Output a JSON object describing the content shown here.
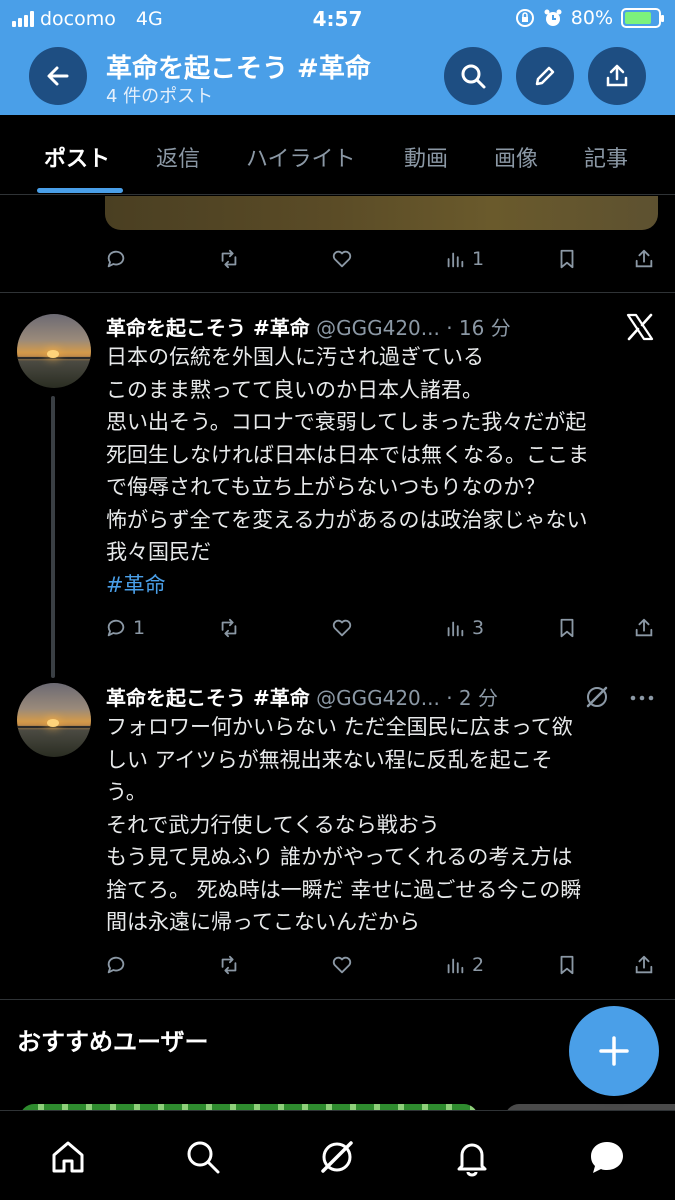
{
  "status_bar": {
    "carrier": "docomo",
    "network": "4G",
    "time": "4:57",
    "battery": "80%"
  },
  "header": {
    "title": "革命を起こそう #革命",
    "subtitle": "4 件のポスト"
  },
  "tabs": [
    {
      "label": "ポスト"
    },
    {
      "label": "返信"
    },
    {
      "label": "ハイライト"
    },
    {
      "label": "動画"
    },
    {
      "label": "画像"
    },
    {
      "label": "記事"
    }
  ],
  "post0": {
    "views": "1"
  },
  "post1": {
    "name": "革命を起こそう #革命",
    "handle_time": "@GGG420... · 16 分",
    "lines": [
      "日本の伝統を外国人に汚され過ぎている",
      "このまま黙ってて良いのか日本人諸君。",
      "思い出そう。コロナで衰弱してしまった我々だが起",
      "死回生しなければ日本は日本では無くなる。ここま",
      "で侮辱されても立ち上がらないつもりなのか？",
      "怖がらず全てを変える力があるのは政治家じゃない",
      "我々国民だ"
    ],
    "hashtag": "#革命",
    "replies": "1",
    "views": "3"
  },
  "post2": {
    "name": "革命を起こそう #革命",
    "handle_time": "@GGG420... · 2 分",
    "lines": [
      "フォロワー何かいらない ただ全国民に広まって欲",
      "しい アイツらが無視出来ない程に反乱を起こそ",
      "う。",
      "それで武力行使してくるなら戦おう",
      "もう見て見ぬふり 誰かがやってくれるの考え方は",
      "捨てろ。 死ぬ時は一瞬だ 幸せに過ごせる今この瞬",
      "間は永遠に帰ってこないんだから"
    ],
    "views": "2"
  },
  "recommended": {
    "title": "おすすめユーザー"
  },
  "colors": {
    "accent": "#4a9fe8",
    "background": "#000000",
    "muted": "#8b98a5"
  }
}
